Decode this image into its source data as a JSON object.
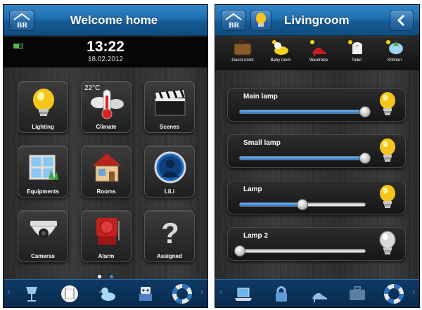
{
  "left_screen": {
    "title": "Welcome home",
    "time": "13:22",
    "date": "18.02.2012",
    "tiles": [
      {
        "label": "Lighting",
        "icon": "bulb-icon"
      },
      {
        "label": "Climate",
        "icon": "thermometer-icon",
        "temperature": "22°C"
      },
      {
        "label": "Scenes",
        "icon": "clapperboard-icon"
      },
      {
        "label": "Equipments",
        "icon": "window-icon"
      },
      {
        "label": "Rooms",
        "icon": "house-icon"
      },
      {
        "label": "LiLi",
        "icon": "avatar-icon"
      },
      {
        "label": "Cameras",
        "icon": "security-camera-icon"
      },
      {
        "label": "Alarm",
        "icon": "alarm-bell-icon"
      },
      {
        "label": "Assigned",
        "icon": "question-mark-icon"
      }
    ],
    "page_dots": {
      "count": 2,
      "active": 2
    },
    "bottom_bar": [
      "wine-glass-icon",
      "plate-cutlery-icon",
      "rubber-duck-icon",
      "robot-icon",
      "lifebuoy-icon"
    ]
  },
  "right_screen": {
    "title": "Livingroom",
    "rooms": [
      {
        "label": "Guest room",
        "icon": "suitcase-icon"
      },
      {
        "label": "Baby room",
        "icon": "duck-icon"
      },
      {
        "label": "Wardrobe",
        "icon": "high-heel-icon"
      },
      {
        "label": "Toilet",
        "icon": "toilet-paper-icon"
      },
      {
        "label": "Kitchen",
        "icon": "kitchen-icon"
      }
    ],
    "lamps": [
      {
        "name": "Main lamp",
        "level": 1.0,
        "on": true
      },
      {
        "name": "Small lamp",
        "level": 1.0,
        "on": true
      },
      {
        "name": "Lamp",
        "level": 0.5,
        "on": true
      },
      {
        "name": "Lamp 2",
        "level": 0.0,
        "on": false
      }
    ],
    "bottom_bar": [
      "laptop-icon",
      "padlock-icon",
      "high-heel-icon",
      "suitcase-icon",
      "lifebuoy-icon"
    ]
  },
  "colors": {
    "header": "#1f6fb0",
    "bottom_bar": "#0e3a66",
    "slider_fill": "#1f78d6",
    "dot_active": "#2f8de0",
    "dot_inactive": "#ffffff"
  }
}
